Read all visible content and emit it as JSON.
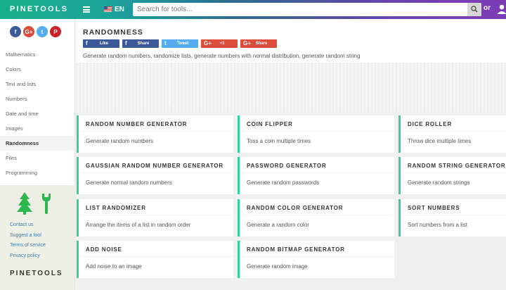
{
  "topbar": {
    "logo": "PINETOOLS",
    "lang": "EN",
    "search_placeholder": "Search for tools...",
    "or_label": "or"
  },
  "sidebar": {
    "social": [
      {
        "label": "f",
        "color": "#3b5998"
      },
      {
        "label": "G+",
        "color": "#dd4b39"
      },
      {
        "label": "t",
        "color": "#55acee"
      },
      {
        "label": "P",
        "color": "#cb2027"
      }
    ],
    "items": [
      {
        "label": "Mathematics"
      },
      {
        "label": "Colors"
      },
      {
        "label": "Text and lists"
      },
      {
        "label": "Numbers"
      },
      {
        "label": "Date and time"
      },
      {
        "label": "Images"
      },
      {
        "label": "Randomness",
        "active": true
      },
      {
        "label": "Files"
      },
      {
        "label": "Programming"
      }
    ],
    "footer_links": [
      "Contact us",
      "Suggest a tool",
      "Terms of service",
      "Privacy policy"
    ],
    "footer_logo": "PINETOOLS"
  },
  "header": {
    "title": "RANDOMNESS",
    "share_buttons": [
      {
        "icon": "f",
        "label": "Like",
        "color": "#3b5998"
      },
      {
        "icon": "f",
        "label": "Share",
        "color": "#3b5998"
      },
      {
        "icon": "t",
        "label": "Tweet",
        "color": "#55acee"
      },
      {
        "icon": "G+",
        "label": "+1",
        "color": "#dd4b39"
      },
      {
        "icon": "G+",
        "label": "Share",
        "color": "#dd4b39"
      }
    ],
    "description": "Generate random numbers, randomize lists, generate numbers with normal distribution, generate random string"
  },
  "accent_color": "#2ed3a0",
  "tools": [
    {
      "title": "RANDOM NUMBER GENERATOR",
      "desc": "Generate random numbers"
    },
    {
      "title": "COIN FLIPPER",
      "desc": "Toss a coin multiple times"
    },
    {
      "title": "DICE ROLLER",
      "desc": "Throw dice multiple times"
    },
    {
      "title": "GAUSSIAN RANDOM NUMBER GENERATOR",
      "desc": "Generate normal random numbers"
    },
    {
      "title": "PASSWORD GENERATOR",
      "desc": "Generate random passwords"
    },
    {
      "title": "RANDOM STRING GENERATOR",
      "desc": "Generate random strings"
    },
    {
      "title": "LIST RANDOMIZER",
      "desc": "Arrange the items of a list in random order"
    },
    {
      "title": "RANDOM COLOR GENERATOR",
      "desc": "Generate a random color"
    },
    {
      "title": "SORT NUMBERS",
      "desc": "Sort numbers from a list"
    },
    {
      "title": "ADD NOISE",
      "desc": "Add noise to an image"
    },
    {
      "title": "RANDOM BITMAP GENERATOR",
      "desc": "Generate random image"
    }
  ]
}
